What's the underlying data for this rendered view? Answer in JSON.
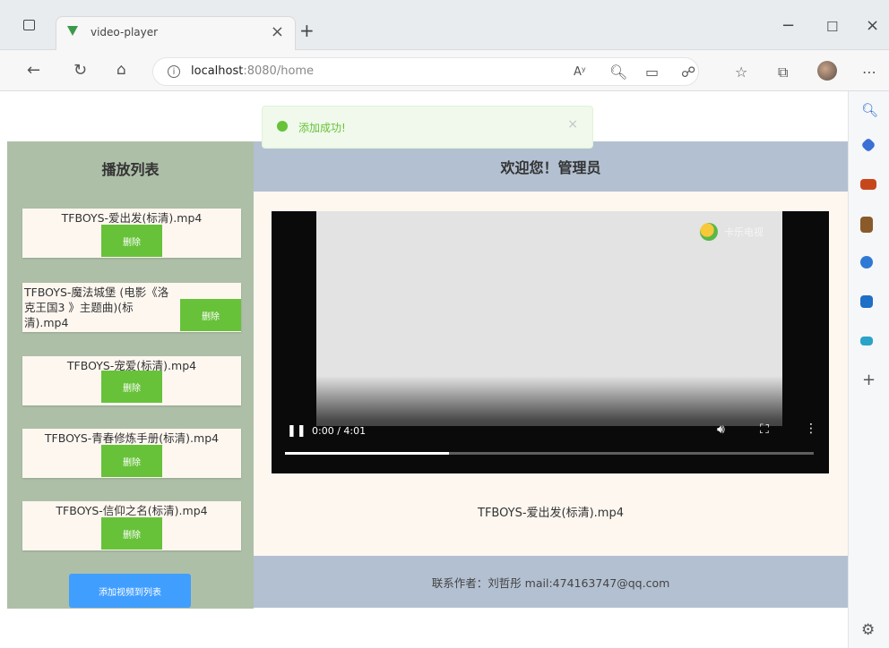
{
  "browser": {
    "tab_title": "video-player",
    "url_host": "localhost",
    "url_path": ":8080/home",
    "new_tab_label": "+"
  },
  "toast": {
    "message": "添加成功!",
    "type": "success",
    "color": "#67c23a"
  },
  "playlist": {
    "title": "播放列表",
    "delete_label": "删除",
    "add_button_label": "添加视频到列表",
    "items": [
      {
        "name": "TFBOYS-爱出发(标清).mp4"
      },
      {
        "name": "TFBOYS-魔法城堡 (电影《洛克王国3 》主题曲)(标清).mp4"
      },
      {
        "name": "TFBOYS-宠爱(标清).mp4"
      },
      {
        "name": "TFBOYS-青春修炼手册(标清).mp4"
      },
      {
        "name": "TFBOYS-信仰之名(标清).mp4"
      }
    ]
  },
  "header": {
    "welcome": "欢迎您！管理员"
  },
  "player": {
    "logo_text": "卡乐电视",
    "time": "0:00 / 4:01",
    "progress": 0.31,
    "now_playing": "TFBOYS-爱出发(标清).mp4"
  },
  "footer": {
    "contact": "联系作者：刘哲彤 mail:474163747@qq.com"
  },
  "colors": {
    "playlist_bg": "#aebfa8",
    "header_bg": "#b3c0d1",
    "main_bg": "#fdf7f0",
    "delete_btn": "#67c23a",
    "add_btn": "#409eff"
  }
}
